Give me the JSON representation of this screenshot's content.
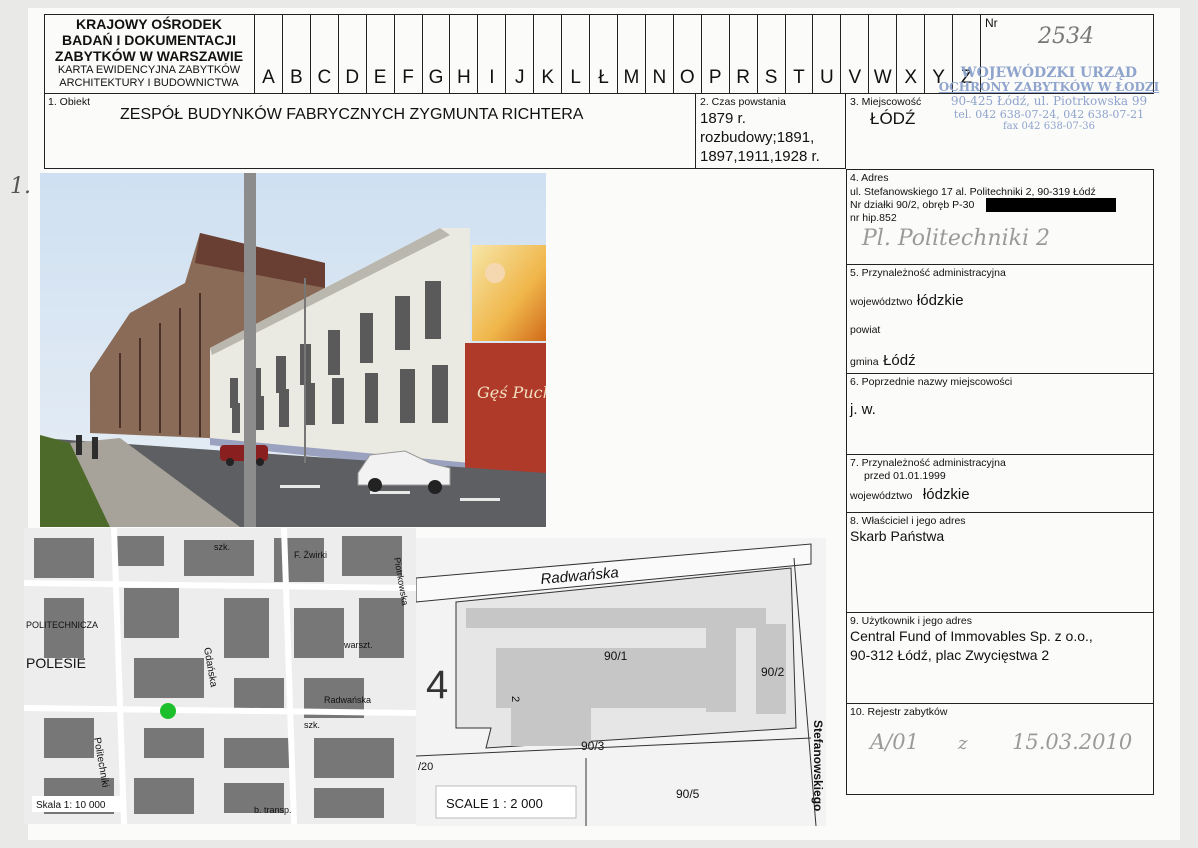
{
  "header": {
    "org_line1": "KRAJOWY OŚRODEK",
    "org_line2": "BADAŃ I DOKUMENTACJI",
    "org_line3": "ZABYTKÓW W WARSZAWIE",
    "card_line1": "KARTA EWIDENCYJNA ZABYTKÓW",
    "card_line2": "ARCHITEKTURY I BUDOWNICTWA",
    "letters": [
      "A",
      "B",
      "C",
      "D",
      "E",
      "F",
      "G",
      "H",
      "I",
      "J",
      "K",
      "L",
      "Ł",
      "M",
      "N",
      "O",
      "P",
      "R",
      "S",
      "T",
      "U",
      "V",
      "W",
      "X",
      "Y",
      "Z"
    ],
    "nr_label": "Nr",
    "nr_value": "2534"
  },
  "stamp": {
    "line1": "WOJEWÓDZKI URZĄD",
    "line2": "OCHRONY ZABYTKÓW W ŁODZI",
    "line3": "90-425 Łódź, ul. Piotrkowska 99",
    "line4": "tel. 042 638-07-24, 042 638-07-21",
    "line5": "fax 042 638-07-36"
  },
  "fields": {
    "f1_label": "1. Obiekt",
    "f1_value": "ZESPÓŁ BUDYNKÓW FABRYCZNYCH ZYGMUNTA RICHTERA",
    "f2_label": "2. Czas powstania",
    "f2_line1": "1879 r.",
    "f2_line2": "rozbudowy;1891,",
    "f2_line3": "1897,1911,1928 r.",
    "f3_label": "3. Miejscowość",
    "f3_value": "ŁÓDŹ",
    "f4_label": "4. Adres",
    "f4_line1": "ul. Stefanowskiego 17 al. Politechniki 2, 90-319 Łódź",
    "f4_line2": "Nr działki 90/2, obręb P-30",
    "f4_line3": "nr hip.852",
    "f4_hand": "Pl. Politechniki 2",
    "f5_label": "5. Przynależność administracyjna",
    "f5_woj_label": "województwo",
    "f5_woj_value": "łódzkie",
    "f5_powiat_label": "powiat",
    "f5_gmina_label": "gmina",
    "f5_gmina_value": "Łódź",
    "f6_label": "6. Poprzednie nazwy miejscowości",
    "f6_value": "j. w.",
    "f7_label": "7. Przynależność administracyjna",
    "f7_sub": "przed 01.01.1999",
    "f7_woj_label": "województwo",
    "f7_woj_value": "łódzkie",
    "f8_label": "8. Właściciel i jego adres",
    "f8_value": "Skarb Państwa",
    "f9_label": "9. Użytkownik i jego adres",
    "f9_line1": "Central Fund of Immovables Sp. z o.o.,",
    "f9_line2": "90-312 Łódź, plac Zwycięstwa 2",
    "f10_label": "10. Rejestr zabytków",
    "f10_reg": "A/01",
    "f10_z": "z",
    "f10_date": "15.03.2010"
  },
  "photo": {
    "margin_number": "1.",
    "sign_text": "Gęś Puch"
  },
  "city_map": {
    "scale": "Skala 1: 10 000",
    "labels": [
      "POLITECHNICZA",
      "POLESIE",
      "Gdańska",
      "Politechniki",
      "Piotrkowska",
      "F. Żwirki",
      "szk.",
      "Radwańska",
      "warszt.",
      "b. transp.",
      "szk."
    ]
  },
  "site_plan": {
    "street_top": "Radwańska",
    "street_right": "Stefanowskiego",
    "plot_main": "90/1",
    "plot_side": "90/2",
    "plot_bottom": "90/3",
    "plot_lower": "90/5",
    "plot_left": "/20",
    "number_4": "4",
    "number_2": "2",
    "scale": "SCALE 1 : 2 000"
  }
}
